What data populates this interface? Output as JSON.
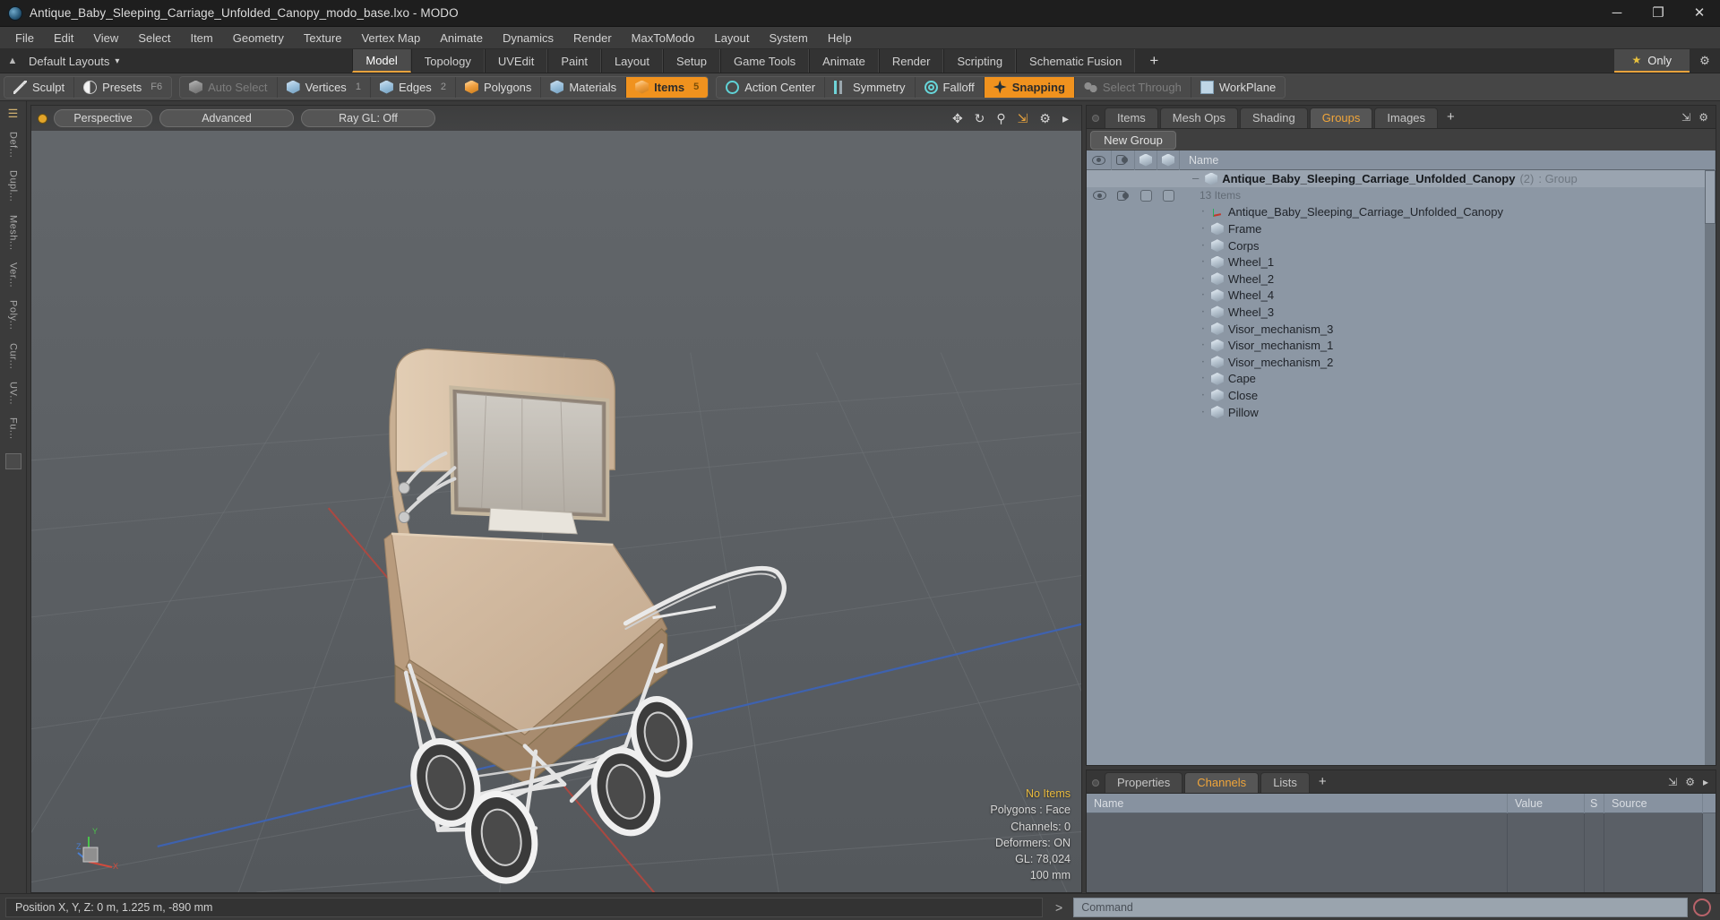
{
  "window": {
    "title": "Antique_Baby_Sleeping_Carriage_Unfolded_Canopy_modo_base.lxo - MODO",
    "app_icon": "modo-logo-icon",
    "minimize": "─",
    "maximize": "❐",
    "close": "✕"
  },
  "menubar": {
    "items": [
      "File",
      "Edit",
      "View",
      "Select",
      "Item",
      "Geometry",
      "Texture",
      "Vertex Map",
      "Animate",
      "Dynamics",
      "Render",
      "MaxToModo",
      "Layout",
      "System",
      "Help"
    ]
  },
  "layoutbar": {
    "default_layouts": "Default Layouts",
    "dropdown_caret": "▾",
    "up_arrow": "▲",
    "tabs": [
      {
        "label": "Model",
        "active": true
      },
      {
        "label": "Topology",
        "active": false
      },
      {
        "label": "UVEdit",
        "active": false
      },
      {
        "label": "Paint",
        "active": false
      },
      {
        "label": "Layout",
        "active": false
      },
      {
        "label": "Setup",
        "active": false
      },
      {
        "label": "Game Tools",
        "active": false
      },
      {
        "label": "Animate",
        "active": false
      },
      {
        "label": "Render",
        "active": false
      },
      {
        "label": "Scripting",
        "active": false
      },
      {
        "label": "Schematic Fusion",
        "active": false
      }
    ],
    "add_tab": "+",
    "only_label": "Only",
    "only_star": "★",
    "gear": "⚙"
  },
  "modebar": {
    "group1": [
      {
        "label": "Sculpt",
        "icon": "pencil-icon",
        "key": "",
        "state": "normal"
      },
      {
        "label": "Presets",
        "icon": "preset-sphere-icon",
        "key": "F6",
        "state": "normal"
      }
    ],
    "group2": [
      {
        "label": "Auto Select",
        "icon": "cube-grey-icon",
        "key": "",
        "state": "dim"
      },
      {
        "label": "Vertices",
        "icon": "cube-blue-icon",
        "key": "1",
        "state": "normal"
      },
      {
        "label": "Edges",
        "icon": "cube-blue-icon",
        "key": "2",
        "state": "normal"
      },
      {
        "label": "Polygons",
        "icon": "cube-orange-icon",
        "key": "",
        "state": "normal"
      },
      {
        "label": "Materials",
        "icon": "cube-blue-icon",
        "key": "",
        "state": "normal"
      },
      {
        "label": "Items",
        "icon": "cube-orange-icon",
        "key": "5",
        "state": "active"
      }
    ],
    "group3": [
      {
        "label": "Action Center",
        "icon": "action-center-icon",
        "key": "",
        "state": "normal"
      },
      {
        "label": "Symmetry",
        "icon": "symmetry-icon",
        "key": "",
        "state": "normal"
      },
      {
        "label": "Falloff",
        "icon": "falloff-icon",
        "key": "",
        "state": "normal"
      },
      {
        "label": "Snapping",
        "icon": "snapping-icon",
        "key": "",
        "state": "active"
      },
      {
        "label": "Select Through",
        "icon": "select-through-icon",
        "key": "",
        "state": "dim"
      },
      {
        "label": "WorkPlane",
        "icon": "workplane-icon",
        "key": "",
        "state": "normal"
      }
    ]
  },
  "leftrail": {
    "tabs": [
      "Def...",
      "Dupl...",
      "Mesh...",
      "Ver...",
      "Poly...",
      "Cur...",
      "UV...",
      "Fu..."
    ],
    "top_icon": "pin-icon",
    "bottom_square": "swatch-icon"
  },
  "viewport": {
    "dot": "view-indicator",
    "view_mode": "Perspective",
    "shading_mode": "Advanced",
    "raygl": "Ray GL: Off",
    "header_icons": [
      "move-icon",
      "rotate-icon",
      "zoom-icon",
      "fit-icon",
      "options-gear-icon",
      "expand-arrow-icon"
    ],
    "stats": {
      "selection": "No Items",
      "polygons": "Polygons : Face",
      "channels": "Channels: 0",
      "deformers": "Deformers: ON",
      "gl": "GL: 78,024",
      "grid": "100 mm"
    },
    "axis_labels": {
      "y": "Y",
      "x": "X",
      "z": "Z"
    }
  },
  "rightpanel": {
    "tabs": [
      {
        "label": "Items",
        "active": false
      },
      {
        "label": "Mesh Ops",
        "active": false
      },
      {
        "label": "Shading",
        "active": false
      },
      {
        "label": "Groups",
        "active": true
      },
      {
        "label": "Images",
        "active": false
      }
    ],
    "add_tab": "+",
    "new_group_button": "New Group",
    "tree_columns": {
      "eye": "visibility-column",
      "shade": "shading-column",
      "col3": "lock-column",
      "col4": "render-column",
      "name": "Name"
    },
    "group": {
      "name": "Antique_Baby_Sleeping_Carriage_Unfolded_Canopy",
      "count_suffix": "(2)",
      "type_label": ": Group",
      "item_count": "13 Items"
    },
    "items": [
      {
        "name": "Antique_Baby_Sleeping_Carriage_Unfolded_Canopy",
        "icon": "locator-axis-icon"
      },
      {
        "name": "Frame",
        "icon": "mesh-cube-icon"
      },
      {
        "name": "Corps",
        "icon": "mesh-cube-icon"
      },
      {
        "name": "Wheel_1",
        "icon": "mesh-cube-icon"
      },
      {
        "name": "Wheel_2",
        "icon": "mesh-cube-icon"
      },
      {
        "name": "Wheel_4",
        "icon": "mesh-cube-icon"
      },
      {
        "name": "Wheel_3",
        "icon": "mesh-cube-icon"
      },
      {
        "name": "Visor_mechanism_3",
        "icon": "mesh-cube-icon"
      },
      {
        "name": "Visor_mechanism_1",
        "icon": "mesh-cube-icon"
      },
      {
        "name": "Visor_mechanism_2",
        "icon": "mesh-cube-icon"
      },
      {
        "name": "Cape",
        "icon": "mesh-cube-icon"
      },
      {
        "name": "Close",
        "icon": "mesh-cube-icon"
      },
      {
        "name": "Pillow",
        "icon": "mesh-cube-icon"
      }
    ]
  },
  "bottompanel": {
    "tabs": [
      {
        "label": "Properties",
        "active": false
      },
      {
        "label": "Channels",
        "active": true
      },
      {
        "label": "Lists",
        "active": false
      }
    ],
    "add_tab": "+",
    "columns": [
      "Name",
      "Value",
      "S",
      "Source"
    ]
  },
  "statusbar": {
    "position_text": "Position X, Y, Z:   0 m, 1.225 m, -890 mm",
    "command_prompt": ">",
    "command_placeholder": "Command",
    "record_icon": "record-icon"
  }
}
